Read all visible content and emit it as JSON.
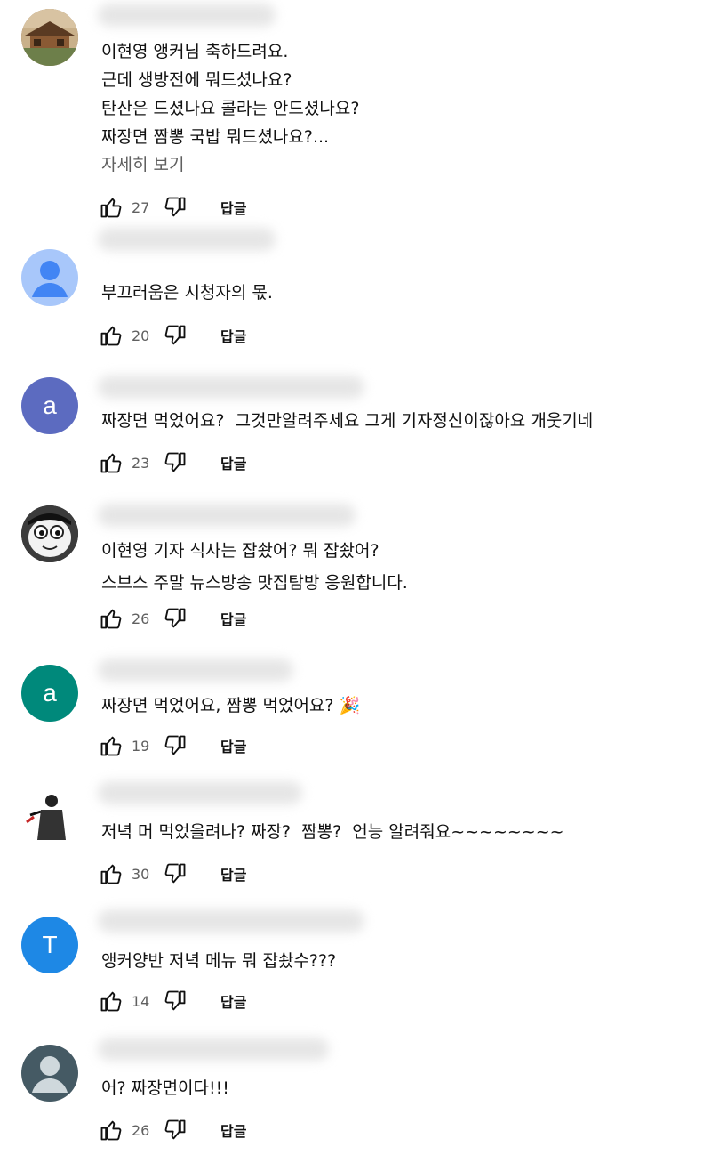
{
  "comments": [
    {
      "avatar_type": "photo-landscape",
      "avatar_letter": "",
      "avatar_color": "#7a5a3a",
      "text": "이현영 앵커님 축하드려요.\n근데 생방전에 뭐드셨나요?\n탄산은 드셨나요 콜라는 안드셨나요?\n짜장면 짬뽕 국밥 뭐드셨나요?...",
      "more_label": "자세히 보기",
      "likes": "27",
      "reply_label": "답글"
    },
    {
      "avatar_type": "default-person",
      "avatar_letter": "",
      "avatar_color": "#a8c7fa",
      "text": "부끄러움은 시청자의 몫.",
      "more_label": "",
      "likes": "20",
      "reply_label": "답글"
    },
    {
      "avatar_type": "letter",
      "avatar_letter": "a",
      "avatar_color": "#5c6bc0",
      "text": "짜장면 먹었어요?  그것만알려주세요 그게 기자정신이잖아요 개웃기네",
      "more_label": "",
      "likes": "23",
      "reply_label": "답글"
    },
    {
      "avatar_type": "cartoon",
      "avatar_letter": "",
      "avatar_color": "#2a2a2a",
      "text": "이현영 기자 식사는 잡솼어? 뭐 잡솼어?\n스브스 주말 뉴스방송 맛집탐방 응원합니다.",
      "more_label": "",
      "likes": "26",
      "reply_label": "답글"
    },
    {
      "avatar_type": "letter",
      "avatar_letter": "a",
      "avatar_color": "#00897b",
      "text": "짜장면 먹었어요, 짬뽕 먹었어요? 🎉",
      "more_label": "",
      "likes": "19",
      "reply_label": "답글"
    },
    {
      "avatar_type": "silhouette",
      "avatar_letter": "",
      "avatar_color": "#ffffff",
      "text": "저녁 머 먹었을려나? 짜장?  짬뽕?  언능 알려줘요~~~~~~~~",
      "more_label": "",
      "likes": "30",
      "reply_label": "답글"
    },
    {
      "avatar_type": "letter",
      "avatar_letter": "T",
      "avatar_color": "#1e88e5",
      "text": "앵커양반 저녁 메뉴 뭐 잡솼수???",
      "more_label": "",
      "likes": "14",
      "reply_label": "답글"
    },
    {
      "avatar_type": "default-person",
      "avatar_letter": "",
      "avatar_color": "#455a64",
      "text": "어? 짜장면이다!!!",
      "more_label": "",
      "likes": "26",
      "reply_label": "답글"
    }
  ]
}
